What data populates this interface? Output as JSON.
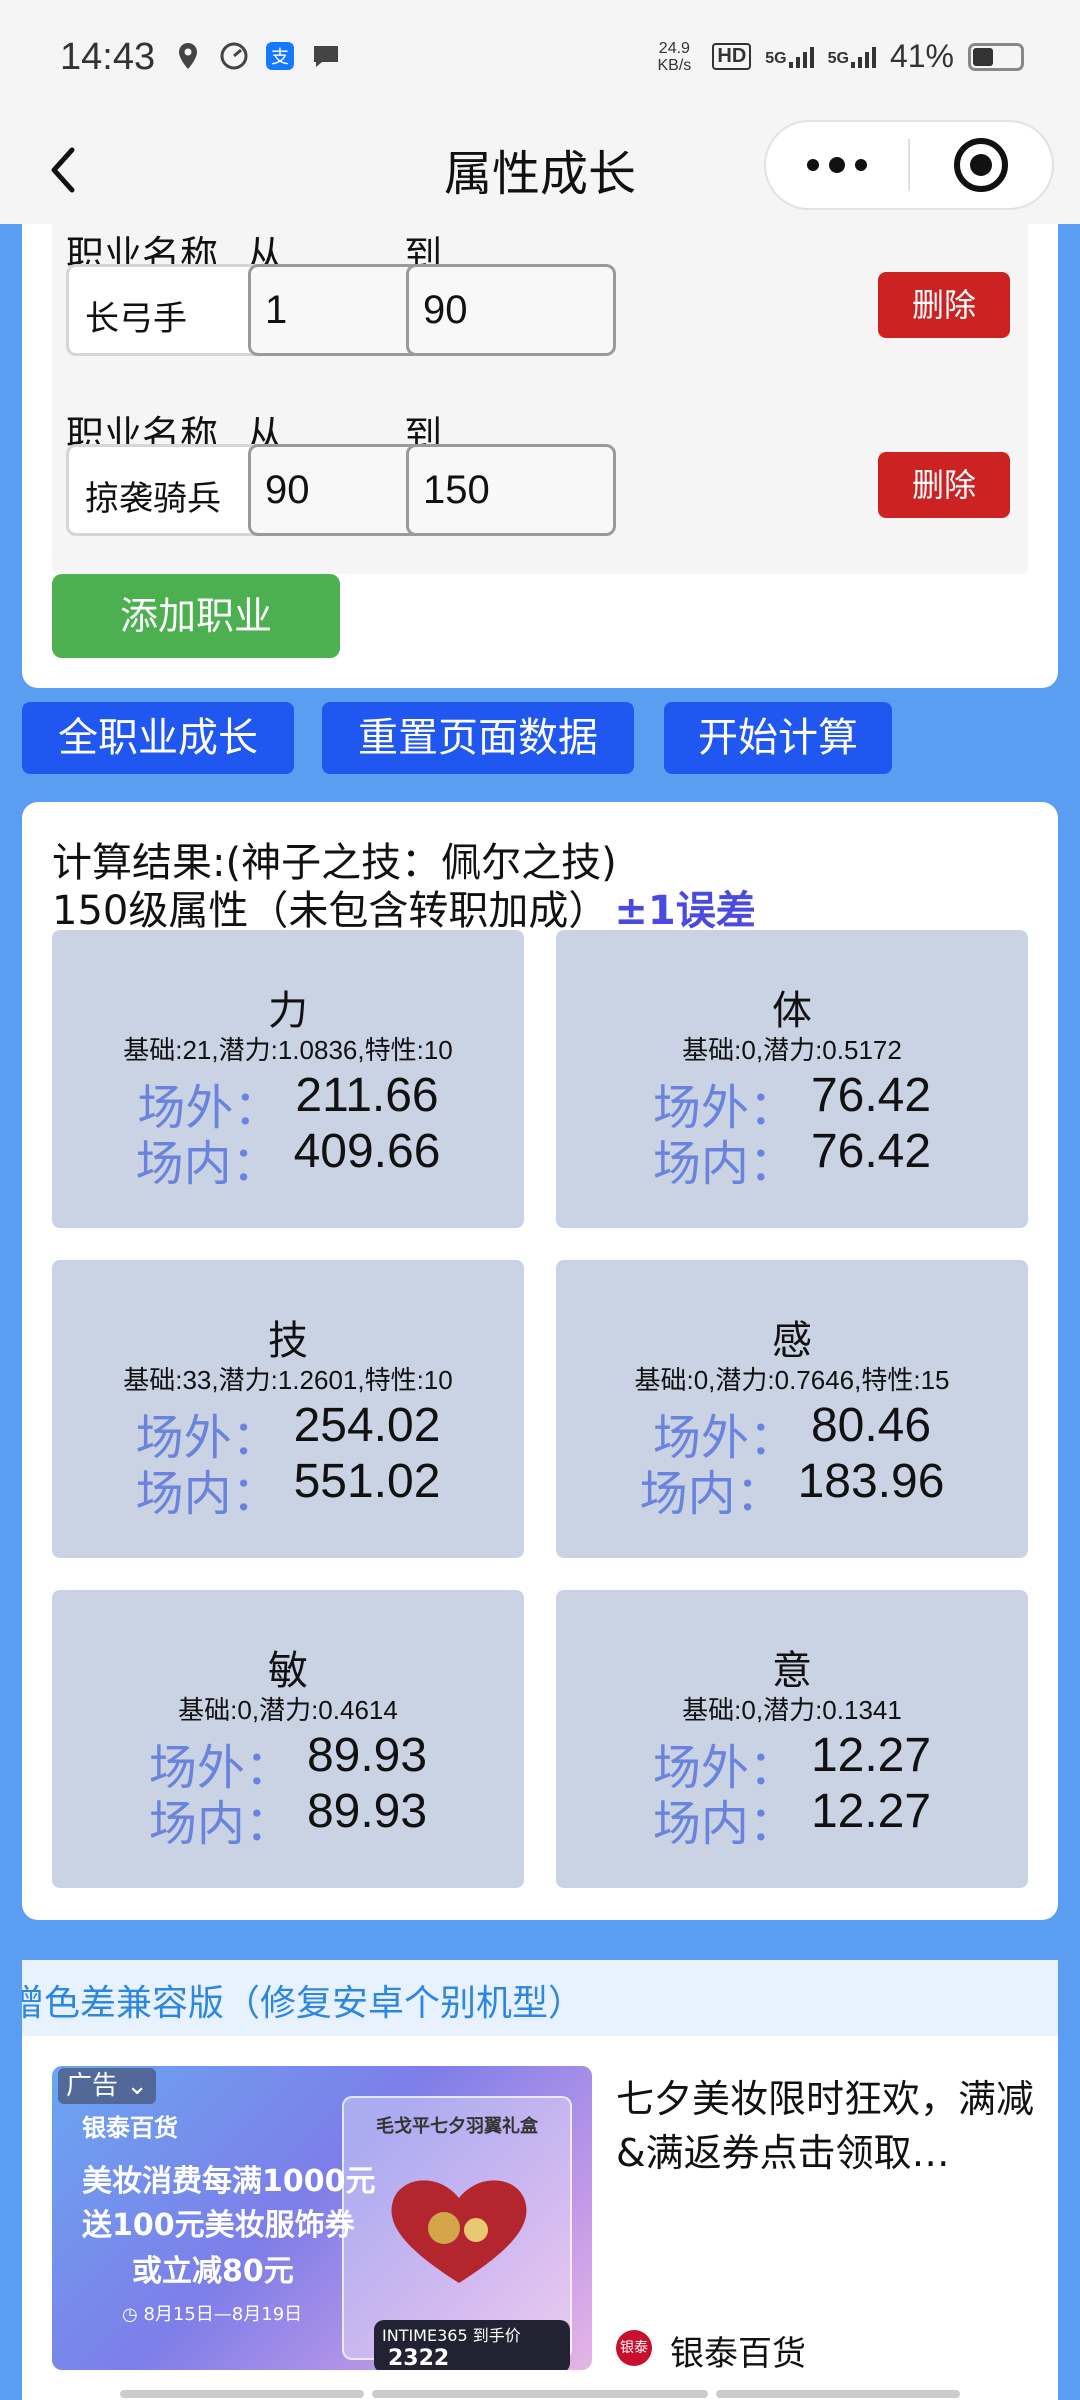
{
  "status_bar": {
    "time": "14:43",
    "net_speed_value": "24.9",
    "net_speed_unit": "KB/s",
    "hd_label": "HD",
    "signal_1": "5G",
    "signal_2": "5G",
    "battery_percent": "41%",
    "battery_level": 0.41
  },
  "title_bar": {
    "title": "属性成长"
  },
  "jobs": {
    "name_label": "职业名称",
    "from_label": "从",
    "to_label": "到",
    "delete_label": "删除",
    "add_label": "添加职业",
    "rows": [
      {
        "job": "长弓手",
        "from": "1",
        "to": "90"
      },
      {
        "job": "掠袭骑兵",
        "from": "90",
        "to": "150"
      }
    ]
  },
  "actions": {
    "all_jobs": "全职业成长",
    "reset": "重置页面数据",
    "calculate": "开始计算"
  },
  "results": {
    "heading": "计算结果:(神子之技：佩尔之技)",
    "subheading": "150级属性（未包含转职加成）",
    "error_note": "±1误差",
    "outside_label": "场外：",
    "inside_label": "场内：",
    "stats": [
      {
        "name": "力",
        "meta": "基础:21,潜力:1.0836,特性:10",
        "outside": "211.66",
        "inside": "409.66"
      },
      {
        "name": "体",
        "meta": "基础:0,潜力:0.5172",
        "outside": "76.42",
        "inside": "76.42"
      },
      {
        "name": "技",
        "meta": "基础:33,潜力:1.2601,特性:10",
        "outside": "254.02",
        "inside": "551.02"
      },
      {
        "name": "感",
        "meta": "基础:0,潜力:0.7646,特性:15",
        "outside": "80.46",
        "inside": "183.96"
      },
      {
        "name": "敏",
        "meta": "基础:0,潜力:0.4614",
        "outside": "89.93",
        "inside": "89.93"
      },
      {
        "name": "意",
        "meta": "基础:0,潜力:0.1341",
        "outside": "12.27",
        "inside": "12.27"
      }
    ]
  },
  "compat_link": "增色差兼容版（修复安卓个别机型）",
  "ad": {
    "tag": "广告",
    "brand": "银泰百货",
    "line1": "美妆消费每满1000元",
    "line2": "送100元美妆服饰券",
    "line3": "或立减80元",
    "date": "8月15日—8月19日",
    "box_title": "毛戈平七夕羽翼礼盒",
    "price_label": "INTIME365 到手价",
    "price": "2322",
    "title": "七夕美妆限时狂欢，满减&满返券点击领取…",
    "source": "银泰百货",
    "source_logo_text": "银泰"
  }
}
